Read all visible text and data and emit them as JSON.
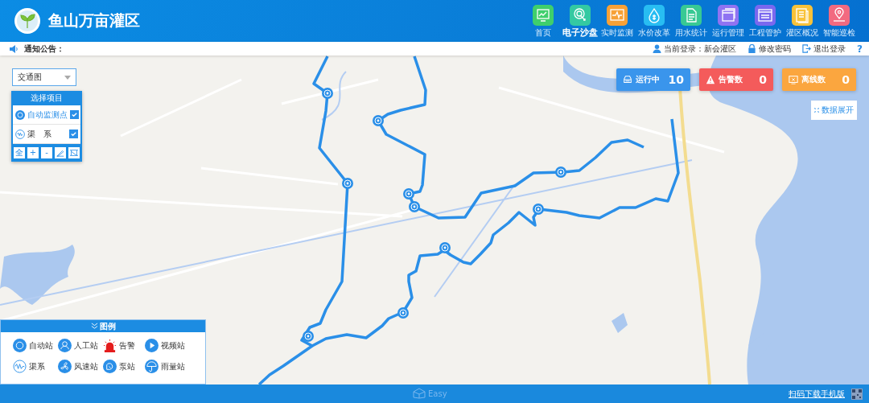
{
  "header": {
    "title": "鱼山万亩灌区",
    "nav": [
      {
        "label": "首页",
        "selected": false,
        "color": "#3fcf6c",
        "kind": "monitor"
      },
      {
        "label": "电子沙盘",
        "selected": true,
        "color": "#34c9a2",
        "kind": "touch"
      },
      {
        "label": "实时监测",
        "selected": false,
        "color": "#f7a136",
        "kind": "pulse"
      },
      {
        "label": "水价改革",
        "selected": false,
        "color": "#28bdf2",
        "kind": "drop"
      },
      {
        "label": "用水统计",
        "selected": false,
        "color": "#38c994",
        "kind": "doc"
      },
      {
        "label": "运行管理",
        "selected": false,
        "color": "#8f73f2",
        "kind": "window"
      },
      {
        "label": "工程管护",
        "selected": false,
        "color": "#7a68ef",
        "kind": "panel"
      },
      {
        "label": "灌区概况",
        "selected": false,
        "color": "#f8c23a",
        "kind": "notes"
      },
      {
        "label": "智能巡检",
        "selected": false,
        "color": "#f26a80",
        "kind": "pin"
      }
    ]
  },
  "notice": {
    "label": "通知公告：",
    "user": "当前登录：新会灌区",
    "links": [
      {
        "label": "修改密码",
        "kind": "lock"
      },
      {
        "label": "退出登录",
        "kind": "logout"
      }
    ],
    "help": "?"
  },
  "map": {
    "layer_select": {
      "value": "交通图"
    },
    "project_panel": {
      "title": "选择项目",
      "items": [
        {
          "label": "自动监测点",
          "checked": true,
          "kind": "point"
        },
        {
          "label": "渠　系",
          "checked": true,
          "kind": "canal"
        }
      ],
      "tools": [
        {
          "kind": "text",
          "label": "全"
        },
        {
          "kind": "text",
          "label": "+"
        },
        {
          "kind": "text",
          "label": "-"
        },
        {
          "kind": "draw"
        },
        {
          "kind": "frame"
        }
      ]
    },
    "stats": [
      {
        "label": "运行中",
        "value": "10",
        "color": "#3a95ec",
        "kind": "running"
      },
      {
        "label": "告警数",
        "value": "0",
        "color": "#f45b5b",
        "kind": "alarm"
      },
      {
        "label": "离线数",
        "value": "0",
        "color": "#fba63f",
        "kind": "offline"
      }
    ],
    "expand_button": "数据展开",
    "legend": {
      "title": "图例",
      "items": [
        {
          "label": "自动站",
          "kind": "auto"
        },
        {
          "label": "人工站",
          "kind": "manual"
        },
        {
          "label": "告警",
          "kind": "alarm"
        },
        {
          "label": "视频站",
          "kind": "video"
        },
        {
          "label": "渠系",
          "kind": "canal"
        },
        {
          "label": "风速站",
          "kind": "wind"
        },
        {
          "label": "泵站",
          "kind": "pump"
        },
        {
          "label": "雨量站",
          "kind": "rain"
        }
      ]
    }
  },
  "footer": {
    "logo": "Easy",
    "download_link": "扫码下载手机版"
  }
}
